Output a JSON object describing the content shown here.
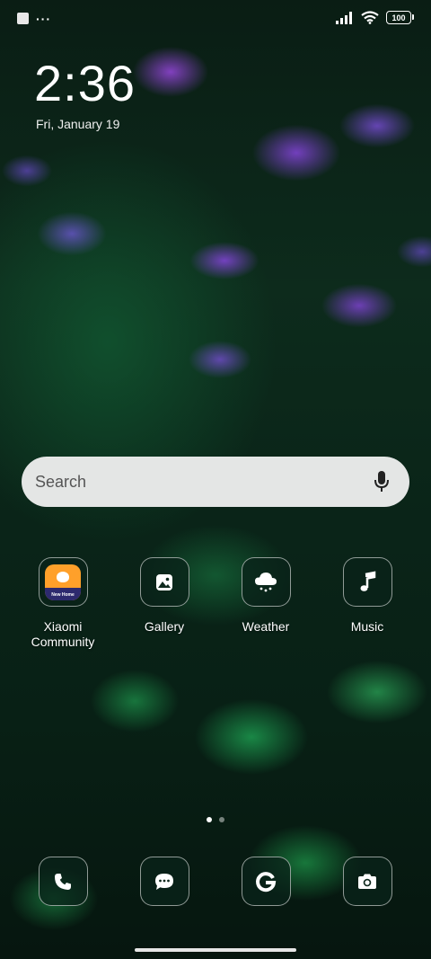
{
  "status_bar": {
    "left_icons": [
      "notification-square-icon",
      "more-dots-icon"
    ],
    "more_glyph": "···",
    "right_icons": [
      "signal-icon",
      "wifi-icon",
      "battery-icon"
    ],
    "battery_level": "100"
  },
  "lock_clock": {
    "time": "2:36",
    "date": "Fri, January 19"
  },
  "search": {
    "placeholder": "Search",
    "icon": "microphone-icon"
  },
  "apps": [
    {
      "label": "Xiaomi Community",
      "icon": "xiaomi-community-icon",
      "icon_text": "New Home"
    },
    {
      "label": "Gallery",
      "icon": "gallery-icon"
    },
    {
      "label": "Weather",
      "icon": "weather-icon"
    },
    {
      "label": "Music",
      "icon": "music-icon"
    }
  ],
  "pager": {
    "pages": 2,
    "active_page": 1
  },
  "dock": [
    {
      "icon": "phone-icon"
    },
    {
      "icon": "messages-icon"
    },
    {
      "icon": "google-icon"
    },
    {
      "icon": "camera-icon"
    }
  ],
  "colors": {
    "icon_background": "#0f2a1e",
    "search_background": "#f0f0f0",
    "community_orange": "#ffa02a"
  }
}
